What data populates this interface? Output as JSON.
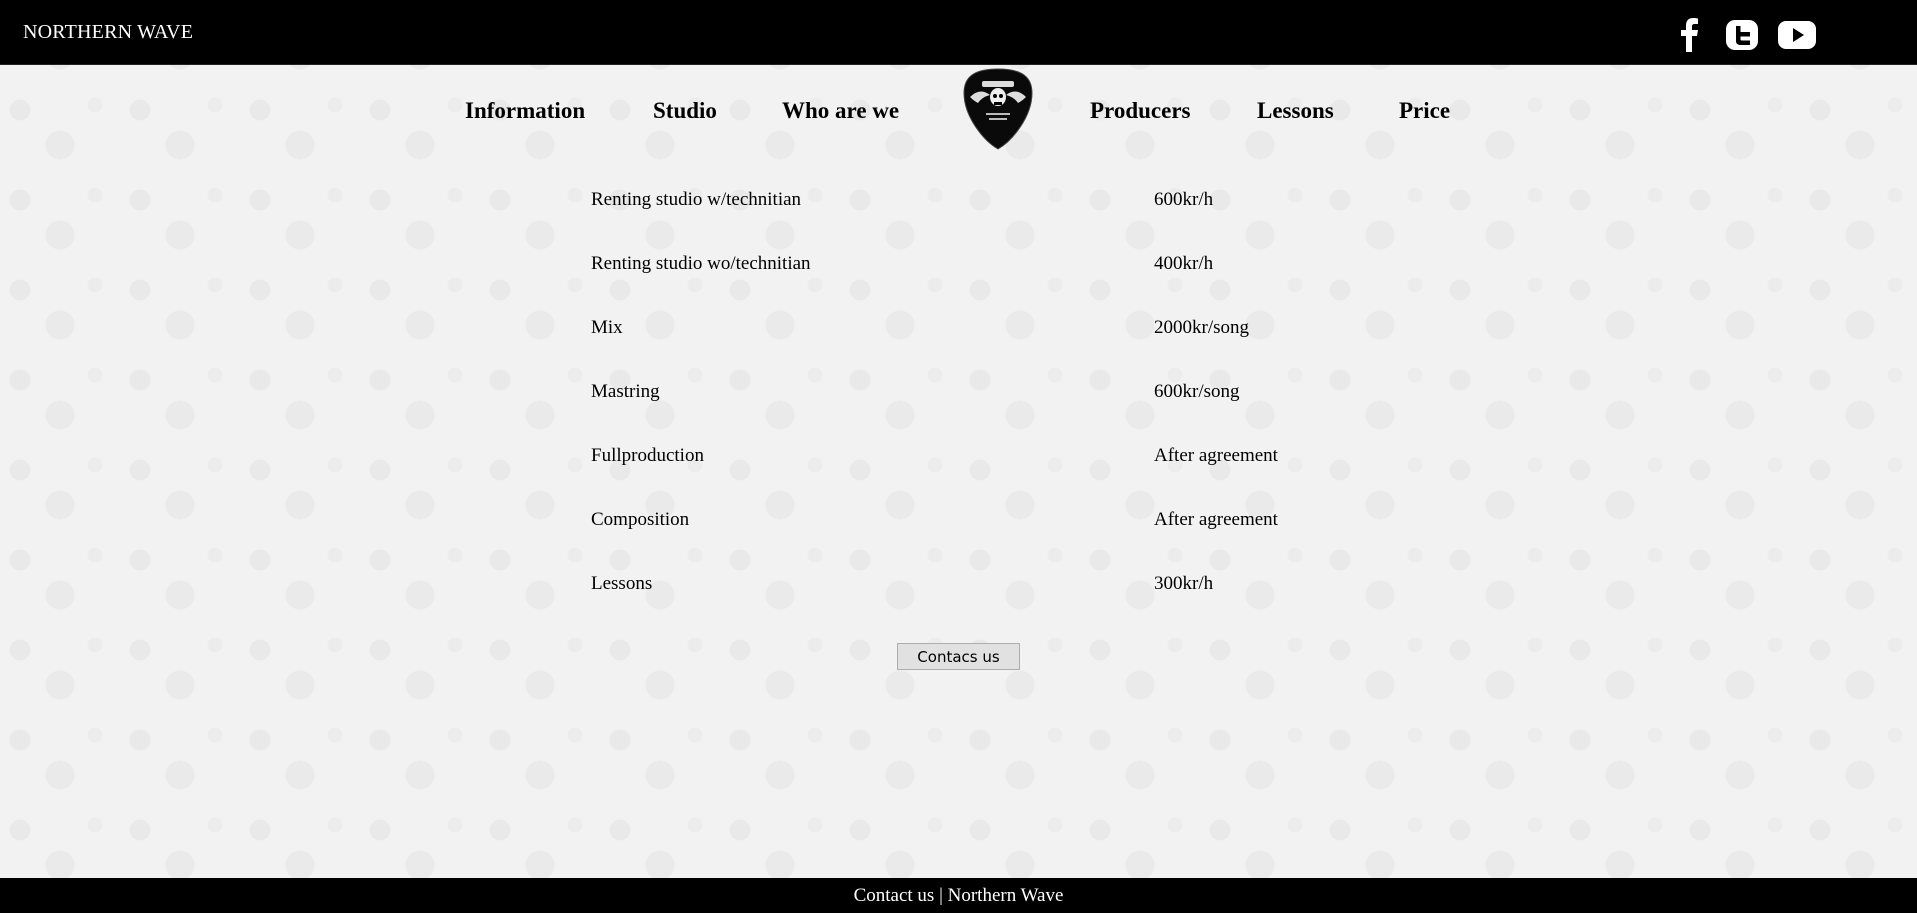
{
  "header": {
    "brand": "NORTHERN WAVE",
    "social": [
      {
        "icon": "facebook-icon"
      },
      {
        "icon": "twitter-icon"
      },
      {
        "icon": "youtube-icon"
      }
    ]
  },
  "nav": {
    "items": [
      {
        "label": "Information"
      },
      {
        "label": "Studio"
      },
      {
        "label": "Who are we"
      },
      {
        "label": "Producers"
      },
      {
        "label": "Lessons"
      },
      {
        "label": "Price"
      }
    ],
    "logo_icon": "guitar-pick-skull-logo"
  },
  "prices": [
    {
      "item": "Renting studio w/technitian",
      "price": "600kr/h"
    },
    {
      "item": "Renting studio wo/technitian",
      "price": "400kr/h"
    },
    {
      "item": "Mix",
      "price": "2000kr/song"
    },
    {
      "item": "Mastring",
      "price": "600kr/song"
    },
    {
      "item": "Fullproduction",
      "price": "After agreement"
    },
    {
      "item": "Composition",
      "price": "After agreement"
    },
    {
      "item": "Lessons",
      "price": "300kr/h"
    }
  ],
  "contact_button": "Contacs us",
  "footer": {
    "text": "Contact us | Northern Wave"
  },
  "colors": {
    "bar": "#000000",
    "background": "#f2f2f2",
    "text": "#000000",
    "bar_text": "#ffffff"
  }
}
